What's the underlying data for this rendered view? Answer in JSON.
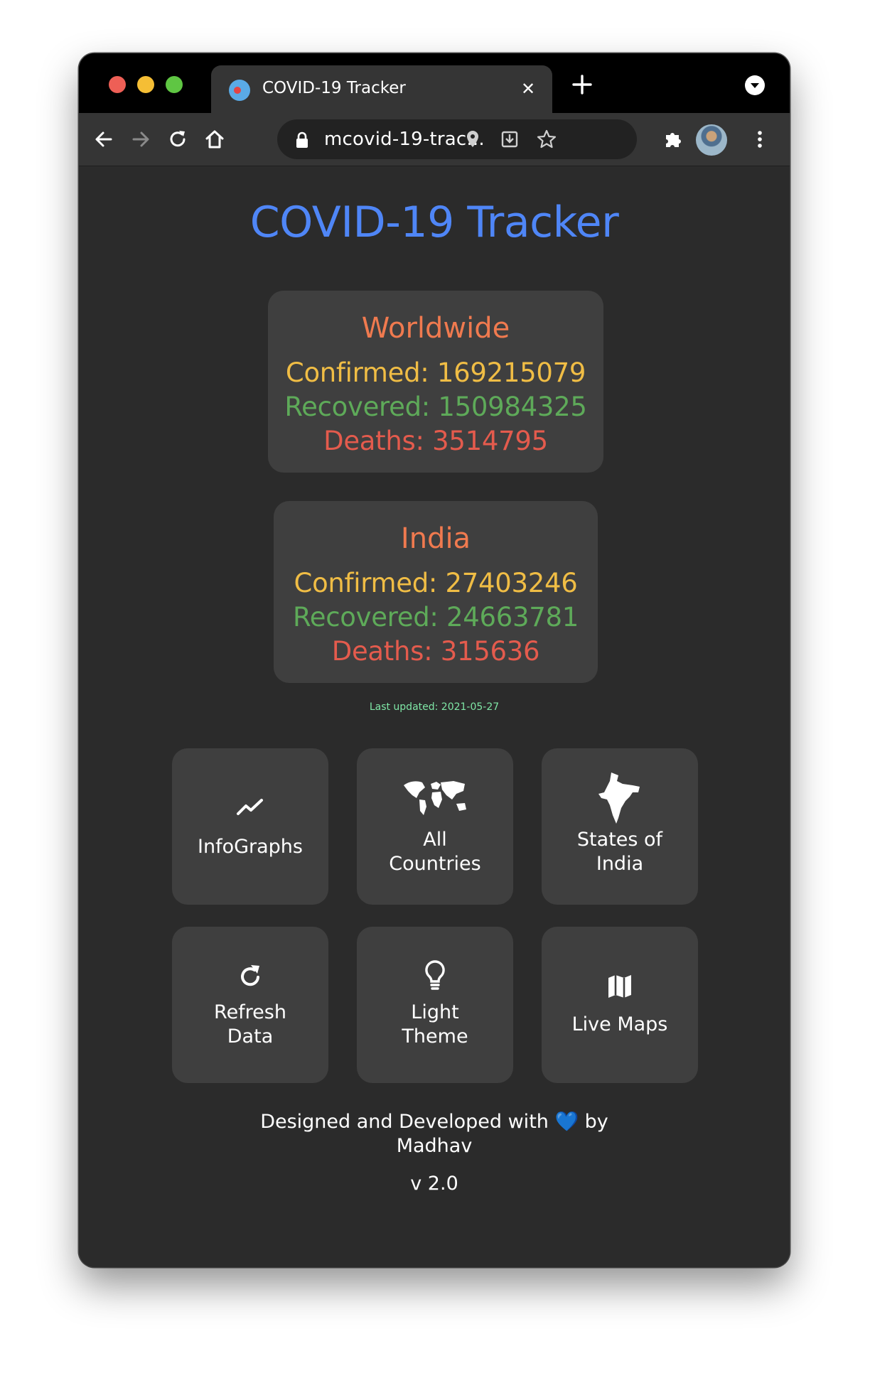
{
  "browser": {
    "tab_title": "COVID-19 Tracker",
    "tab_close": "✕",
    "url": "mcovid-19-trac..."
  },
  "page": {
    "title": "COVID-19 Tracker",
    "worldwide": {
      "heading": "Worldwide",
      "confirmed": "Confirmed: 169215079",
      "recovered": "Recovered: 150984325",
      "deaths": "Deaths: 3514795"
    },
    "india": {
      "heading": "India",
      "confirmed": "Confirmed: 27403246",
      "recovered": "Recovered: 24663781",
      "deaths": "Deaths: 315636"
    },
    "last_updated": "Last updated: 2021-05-27",
    "tiles": [
      {
        "label": "InfoGraphs",
        "icon": "chart-line-icon"
      },
      {
        "label_line1": "All",
        "label_line2": "Countries",
        "icon": "world-map-icon"
      },
      {
        "label_line1": "States of",
        "label_line2": "India",
        "icon": "india-map-icon"
      },
      {
        "label_line1": "Refresh",
        "label_line2": "Data",
        "icon": "refresh-icon"
      },
      {
        "label_line1": "Light",
        "label_line2": "Theme",
        "icon": "lightbulb-icon"
      },
      {
        "label": "Live Maps",
        "icon": "map-icon"
      }
    ],
    "footer": {
      "credit_line1": "Designed and Developed with 💙 by",
      "credit_line2": "Madhav",
      "version": "v 2.0"
    }
  },
  "colors": {
    "title_blue": "#4f86f7",
    "heading_orange": "#f07a4f",
    "confirmed_yellow": "#f0bd45",
    "recovered_green": "#5eaa59",
    "deaths_red": "#e45b4d",
    "last_updated_green": "#7fe7a6",
    "card_bg": "#3f3f3f",
    "page_bg": "#2b2b2b"
  }
}
